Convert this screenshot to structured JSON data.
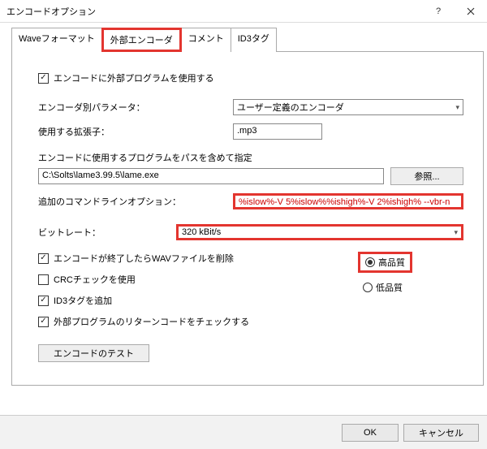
{
  "window": {
    "title": "エンコードオプション"
  },
  "tabs": {
    "wave": "Waveフォーマット",
    "ext": "外部エンコーダ",
    "comment": "コメント",
    "id3": "ID3タグ"
  },
  "form": {
    "use_ext_label": "エンコードに外部プログラムを使用する",
    "param_label": "エンコーダ別パラメータ：",
    "param_value": "ユーザー定義のエンコーダ",
    "ext_label": "使用する拡張子：",
    "ext_value": ".mp3",
    "prog_label": "エンコードに使用するプログラムをパスを含めて指定",
    "prog_value": "C:\\Solts\\lame3.99.5\\lame.exe",
    "browse": "参照...",
    "cmdline_label": "追加のコマンドラインオプション：",
    "cmdline_value": "%islow%-V 5%islow%%ishigh%-V 2%ishigh% --vbr-n",
    "bitrate_label": "ビットレート：",
    "bitrate_value": "320 kBit/s",
    "del_wav": "エンコードが終了したらWAVファイルを削除",
    "crc": "CRCチェックを使用",
    "id3add": "ID3タグを追加",
    "check_ret": "外部プログラムのリターンコードをチェックする",
    "hq": "高品質",
    "lq": "低品質",
    "test": "エンコードのテスト"
  },
  "footer": {
    "ok": "OK",
    "cancel": "キャンセル"
  }
}
